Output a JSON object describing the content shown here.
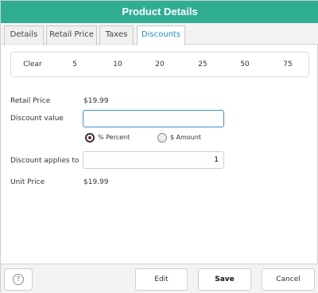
{
  "title": "Product Details",
  "tabs": [
    {
      "label": "Details",
      "active": false
    },
    {
      "label": "Retail Price",
      "active": false
    },
    {
      "label": "Taxes",
      "active": false
    },
    {
      "label": "Discounts",
      "active": true
    }
  ],
  "quick_buttons": [
    "Clear",
    "5",
    "10",
    "20",
    "25",
    "50",
    "75"
  ],
  "fields": {
    "retail_price_label": "Retail Price",
    "retail_price_value": "$19.99",
    "discount_value_label": "Discount value",
    "discount_value_input": "",
    "discount_applies_label": "Discount applies to",
    "discount_applies_value": "1",
    "unit_price_label": "Unit Price",
    "unit_price_value": "$19.99"
  },
  "discount_type": {
    "percent_label": "% Percent",
    "amount_label": "$ Amount",
    "selected": "percent"
  },
  "footer": {
    "help_label": "?",
    "edit_label": "Edit",
    "save_label": "Save",
    "cancel_label": "Cancel"
  },
  "colors": {
    "title_bar": "#2fae94",
    "active_tab_text": "#1f8fbd",
    "focus_border": "#3a8fd9"
  }
}
